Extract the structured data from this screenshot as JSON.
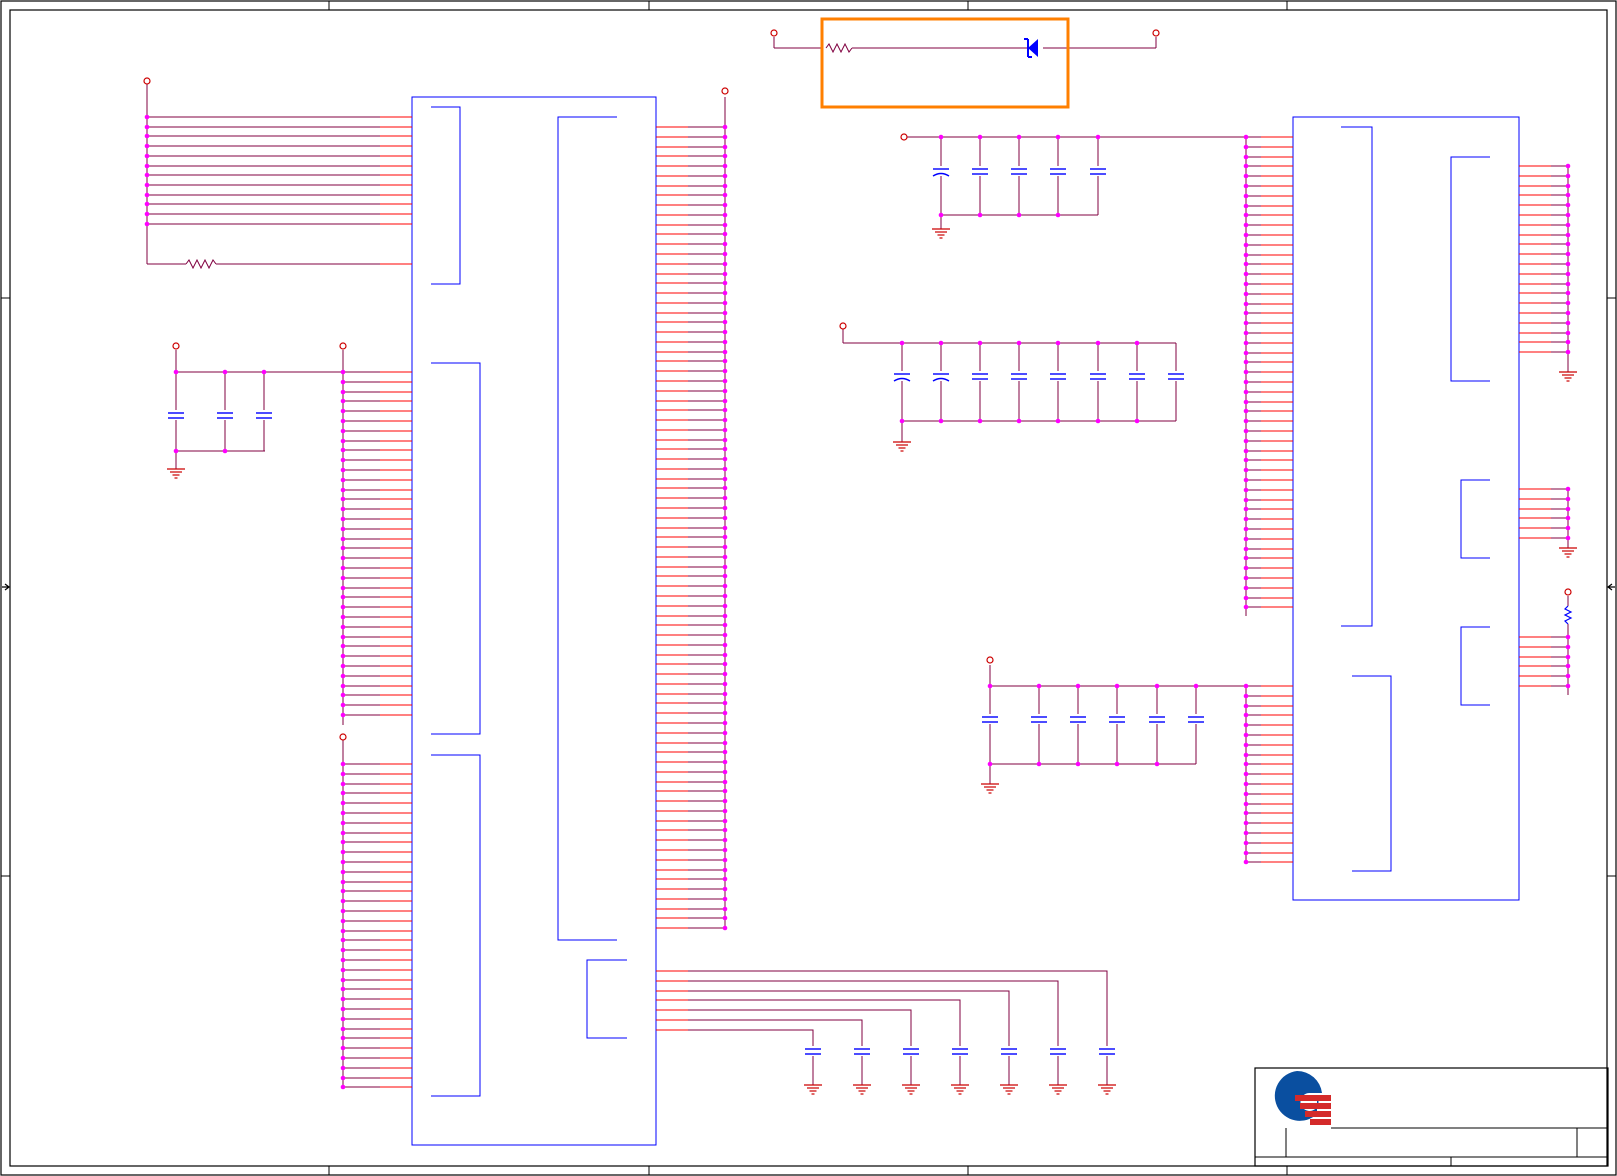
{
  "app": {
    "view": "schematic-sheet"
  },
  "colors": {
    "wire": "#800040",
    "pin": "#ff0000",
    "part": "#0000ff",
    "junction": "#ff00ff",
    "power_port": "#cc0000",
    "selection": "#ff7f00",
    "frame": "#000000",
    "logo_blue": "#0a4fa0",
    "logo_red": "#d42a2a"
  },
  "icons": {
    "logo": "company-logo",
    "ground": "ground-symbol-icon",
    "power": "power-port-icon",
    "resistor": "resistor-icon",
    "capacitor": "capacitor-icon",
    "diode": "diode-icon",
    "zone_marker": "zone-arrow-icon"
  },
  "selection": {
    "state": "highlighted"
  },
  "title_block": {
    "title": "",
    "sheet": ""
  }
}
